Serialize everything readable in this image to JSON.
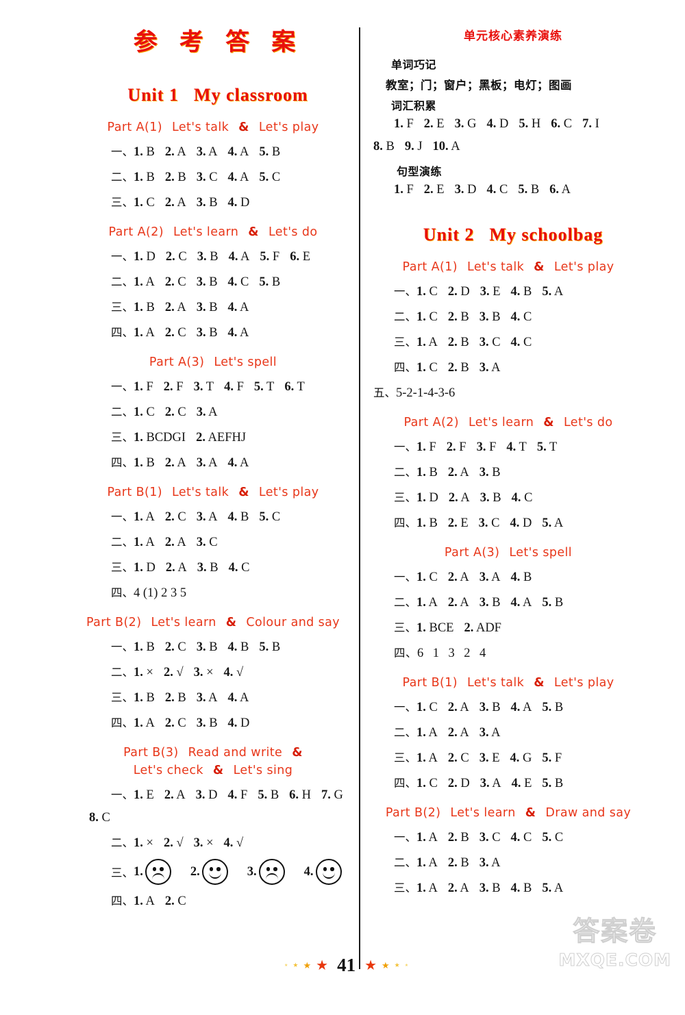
{
  "doc": {
    "title": "参 考 答 案",
    "page_number": "41"
  },
  "watermark": {
    "cn": "答案卷",
    "en": "MXQE.COM"
  },
  "left_column": {
    "unit": {
      "label": "Unit 1",
      "name": "My classroom"
    },
    "sections": [
      {
        "head": {
          "part": "Part A(1)",
          "desc1": "Let's talk",
          "amp": "&",
          "desc2": "Let's play"
        },
        "rows": [
          {
            "cn": "一、",
            "items": [
              "1. B",
              "2. A",
              "3. A",
              "4. A",
              "5. B"
            ]
          },
          {
            "cn": "二、",
            "items": [
              "1. B",
              "2. B",
              "3. C",
              "4. A",
              "5. C"
            ]
          },
          {
            "cn": "三、",
            "items": [
              "1. C",
              "2. A",
              "3. B",
              "4. D"
            ]
          }
        ]
      },
      {
        "head": {
          "part": "Part A(2)",
          "desc1": "Let's learn",
          "amp": "&",
          "desc2": "Let's do"
        },
        "rows": [
          {
            "cn": "一、",
            "items": [
              "1. D",
              "2. C",
              "3. B",
              "4. A",
              "5. F",
              "6. E"
            ]
          },
          {
            "cn": "二、",
            "items": [
              "1. A",
              "2. C",
              "3. B",
              "4. C",
              "5. B"
            ]
          },
          {
            "cn": "三、",
            "items": [
              "1. B",
              "2. A",
              "3. B",
              "4. A"
            ]
          },
          {
            "cn": "四、",
            "items": [
              "1. A",
              "2. C",
              "3. B",
              "4. A"
            ]
          }
        ]
      },
      {
        "head": {
          "part": "Part A(3)",
          "desc1": "Let's spell",
          "amp": "",
          "desc2": ""
        },
        "rows": [
          {
            "cn": "一、",
            "items": [
              "1. F",
              "2. F",
              "3. T",
              "4. F",
              "5. T",
              "6. T"
            ]
          },
          {
            "cn": "二、",
            "items": [
              "1. C",
              "2. C",
              "3. A"
            ]
          },
          {
            "cn": "三、",
            "items": [
              "1. BCDGI",
              "2. AEFHJ"
            ]
          },
          {
            "cn": "四、",
            "items": [
              "1. B",
              "2. A",
              "3. A",
              "4. A"
            ]
          }
        ]
      },
      {
        "head": {
          "part": "Part B(1)",
          "desc1": "Let's talk",
          "amp": "&",
          "desc2": "Let's play"
        },
        "rows": [
          {
            "cn": "一、",
            "items": [
              "1. A",
              "2. C",
              "3. A",
              "4. B",
              "5. C"
            ]
          },
          {
            "cn": "二、",
            "items": [
              "1. A",
              "2. A",
              "3. C"
            ]
          },
          {
            "cn": "三、",
            "items": [
              "1. D",
              "2. A",
              "3. B",
              "4. C"
            ]
          },
          {
            "cn": "四、",
            "items": [
              "4 (1) 2 3 5"
            ]
          }
        ]
      },
      {
        "head": {
          "part": "Part B(2)",
          "desc1": "Let's learn",
          "amp": "&",
          "desc2": "Colour and say"
        },
        "rows": [
          {
            "cn": "一、",
            "items": [
              "1. B",
              "2. C",
              "3. B",
              "4. B",
              "5. B"
            ]
          },
          {
            "cn": "二、",
            "items": [
              "1. ×",
              "2. √",
              "3. ×",
              "4. √"
            ]
          },
          {
            "cn": "三、",
            "items": [
              "1. B",
              "2. B",
              "3. A",
              "4. A"
            ]
          },
          {
            "cn": "四、",
            "items": [
              "1. A",
              "2. C",
              "3. B",
              "4. D"
            ]
          }
        ]
      },
      {
        "head": {
          "part": "Part B(3)",
          "desc1": "Read and write",
          "amp": "&",
          "desc2": ""
        },
        "head_line2": {
          "desc1": "Let's check",
          "amp": "&",
          "desc2": "Let's sing"
        },
        "rows": [
          {
            "cn": "一、",
            "items": [
              "1. E",
              "2. A",
              "3. D",
              "4. F",
              "5. B",
              "6. H",
              "7. G"
            ]
          },
          {
            "cn": "",
            "items": [
              "8. C"
            ],
            "wrap": true
          },
          {
            "cn": "二、",
            "items": [
              "1. ×",
              "2. √",
              "3. ×",
              "4. √"
            ]
          }
        ],
        "faces_row": {
          "cn": "三、",
          "faces": [
            {
              "label": "1.",
              "type": "sad"
            },
            {
              "label": "2.",
              "type": "happy"
            },
            {
              "label": "3.",
              "type": "sad"
            },
            {
              "label": "4.",
              "type": "happy"
            }
          ]
        },
        "rows_after": [
          {
            "cn": "四、",
            "items": [
              "1. A",
              "2. C"
            ]
          }
        ]
      }
    ]
  },
  "right_column": {
    "core_drill": {
      "title": "单元核心素养演练",
      "sub1": "单词巧记",
      "sub1_content": "教室；门；窗户；黑板；电灯；图画",
      "sub2": "词汇积累",
      "sub2_rows": [
        {
          "items": [
            "1. F",
            "2. E",
            "3. G",
            "4. D",
            "5. H",
            "6. C",
            "7. I"
          ]
        },
        {
          "items": [
            "8. B",
            "9. J",
            "10. A"
          ],
          "wrap": true
        }
      ],
      "sub3": "句型演练",
      "sub3_rows": [
        {
          "items": [
            "1. F",
            "2. E",
            "3. D",
            "4. C",
            "5. B",
            "6. A"
          ]
        }
      ]
    },
    "unit": {
      "label": "Unit 2",
      "name": "My schoolbag"
    },
    "sections": [
      {
        "head": {
          "part": "Part A(1)",
          "desc1": "Let's talk",
          "amp": "&",
          "desc2": "Let's play"
        },
        "rows": [
          {
            "cn": "一、",
            "items": [
              "1. C",
              "2. D",
              "3. E",
              "4. B",
              "5. A"
            ]
          },
          {
            "cn": "二、",
            "items": [
              "1. C",
              "2. B",
              "3. B",
              "4. C"
            ]
          },
          {
            "cn": "三、",
            "items": [
              "1. A",
              "2. B",
              "3. C",
              "4. C"
            ]
          },
          {
            "cn": "四、",
            "items": [
              "1. C",
              "2. B",
              "3. A"
            ]
          },
          {
            "cn": "五、",
            "items": [
              "5-2-1-4-3-6"
            ],
            "nopad": true
          }
        ]
      },
      {
        "head": {
          "part": "Part A(2)",
          "desc1": "Let's learn",
          "amp": "&",
          "desc2": "Let's do"
        },
        "rows": [
          {
            "cn": "一、",
            "items": [
              "1. F",
              "2. F",
              "3. F",
              "4. T",
              "5. T"
            ]
          },
          {
            "cn": "二、",
            "items": [
              "1. B",
              "2. A",
              "3. B"
            ]
          },
          {
            "cn": "三、",
            "items": [
              "1. D",
              "2. A",
              "3. B",
              "4. C"
            ]
          },
          {
            "cn": "四、",
            "items": [
              "1. B",
              "2. E",
              "3. C",
              "4. D",
              "5. A"
            ]
          }
        ]
      },
      {
        "head": {
          "part": "Part A(3)",
          "desc1": "Let's spell",
          "amp": "",
          "desc2": ""
        },
        "rows": [
          {
            "cn": "一、",
            "items": [
              "1. C",
              "2. A",
              "3. A",
              "4. B"
            ]
          },
          {
            "cn": "二、",
            "items": [
              "1. A",
              "2. A",
              "3. B",
              "4. A",
              "5. B"
            ]
          },
          {
            "cn": "三、",
            "items": [
              "1. BCE",
              "2. ADF"
            ]
          },
          {
            "cn": "四、",
            "items": [
              "6",
              "1",
              "3",
              "2",
              "4"
            ],
            "seq": true
          }
        ]
      },
      {
        "head": {
          "part": "Part B(1)",
          "desc1": "Let's talk",
          "amp": "&",
          "desc2": "Let's play"
        },
        "rows": [
          {
            "cn": "一、",
            "items": [
              "1. C",
              "2. A",
              "3. B",
              "4. A",
              "5. B"
            ]
          },
          {
            "cn": "二、",
            "items": [
              "1. A",
              "2. A",
              "3. A"
            ]
          },
          {
            "cn": "三、",
            "items": [
              "1. A",
              "2. C",
              "3. E",
              "4. G",
              "5. F"
            ]
          },
          {
            "cn": "四、",
            "items": [
              "1. C",
              "2. D",
              "3. A",
              "4. E",
              "5. B"
            ]
          }
        ]
      },
      {
        "head": {
          "part": "Part B(2)",
          "desc1": "Let's learn",
          "amp": "&",
          "desc2": "Draw and say"
        },
        "rows": [
          {
            "cn": "一、",
            "items": [
              "1. A",
              "2. B",
              "3. C",
              "4. C",
              "5. C"
            ]
          },
          {
            "cn": "二、",
            "items": [
              "1. A",
              "2. B",
              "3. A"
            ]
          },
          {
            "cn": "三、",
            "items": [
              "1. A",
              "2. A",
              "3. B",
              "4. B",
              "5. A"
            ]
          }
        ]
      }
    ]
  }
}
